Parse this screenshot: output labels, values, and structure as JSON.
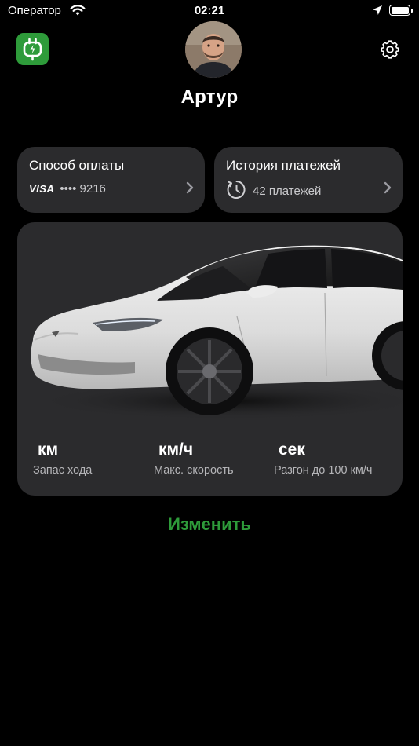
{
  "status_bar": {
    "carrier": "Оператор",
    "time": "02:21"
  },
  "profile": {
    "name": "Артур"
  },
  "payment_card": {
    "title": "Способ оплаты",
    "card_brand": "VISA",
    "card_mask": "•••• 9216"
  },
  "history_card": {
    "title": "История платежей",
    "count_text": "42 платежей"
  },
  "vehicle": {
    "specs": [
      {
        "unit": "км",
        "label": "Запас хода"
      },
      {
        "unit": "км/ч",
        "label": "Макс. скорость"
      },
      {
        "unit": "сек",
        "label": "Разгон до 100 км/ч"
      }
    ]
  },
  "actions": {
    "edit_label": "Изменить"
  },
  "colors": {
    "accent": "#2e9b3a",
    "card_bg": "#2b2b2d",
    "background": "#000000"
  }
}
